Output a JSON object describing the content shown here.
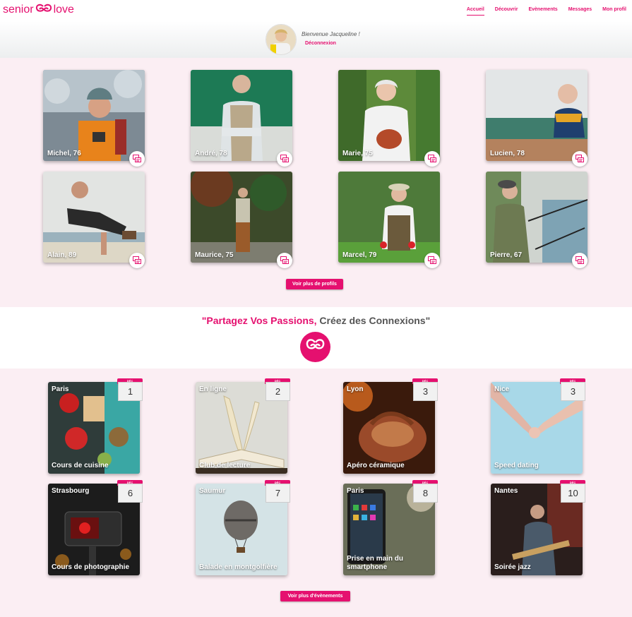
{
  "brand": {
    "part1": "senior",
    "part2": "love",
    "accent": "#e5106f"
  },
  "nav": [
    {
      "label": "Accueil",
      "active": true
    },
    {
      "label": "Découvrir"
    },
    {
      "label": "Evènements"
    },
    {
      "label": "Messages"
    },
    {
      "label": "Mon profil"
    }
  ],
  "user": {
    "welcome": "Bienvenue Jacqueline !",
    "logout": "Déconnexion"
  },
  "profiles": [
    {
      "name": "Michel, 76",
      "icon": "chat-icon"
    },
    {
      "name": "André, 78",
      "icon": "chat-icon"
    },
    {
      "name": "Marie, 75",
      "icon": "chat-icon"
    },
    {
      "name": "Lucien, 78",
      "icon": "chat-icon"
    },
    {
      "name": "Alain, 89",
      "icon": "chat-icon"
    },
    {
      "name": "Maurice, 75",
      "icon": "chat-icon"
    },
    {
      "name": "Marcel, 79",
      "icon": "chat-icon"
    },
    {
      "name": "Pierre, 67",
      "icon": "chat-icon"
    }
  ],
  "more_profiles": "Voir plus de profils",
  "tagline": {
    "pink": "\"Partagez Vos Passions,",
    "rest": " Créez des Connexions\""
  },
  "events": [
    {
      "city": "Paris",
      "title": "Cours de cuisine",
      "month": "DÉC",
      "day": "1"
    },
    {
      "city": "En ligne",
      "title": "Club de lecture",
      "month": "DÉC",
      "day": "2"
    },
    {
      "city": "Lyon",
      "title": "Apéro céramique",
      "month": "DÉC",
      "day": "3"
    },
    {
      "city": "Nice",
      "title": "Speed dating",
      "month": "DÉC",
      "day": "3"
    },
    {
      "city": "Strasbourg",
      "title": "Cours de photographie",
      "month": "DÉC",
      "day": "6"
    },
    {
      "city": "Saumur",
      "title": "Balade en montgolfière",
      "month": "DÉC",
      "day": "7"
    },
    {
      "city": "Paris",
      "title": "Prise en main du smartphone",
      "month": "DÉC",
      "day": "8"
    },
    {
      "city": "Nantes",
      "title": "Soirée jazz",
      "month": "DÉC",
      "day": "10"
    }
  ],
  "more_events": "Voir plus d'évènements"
}
